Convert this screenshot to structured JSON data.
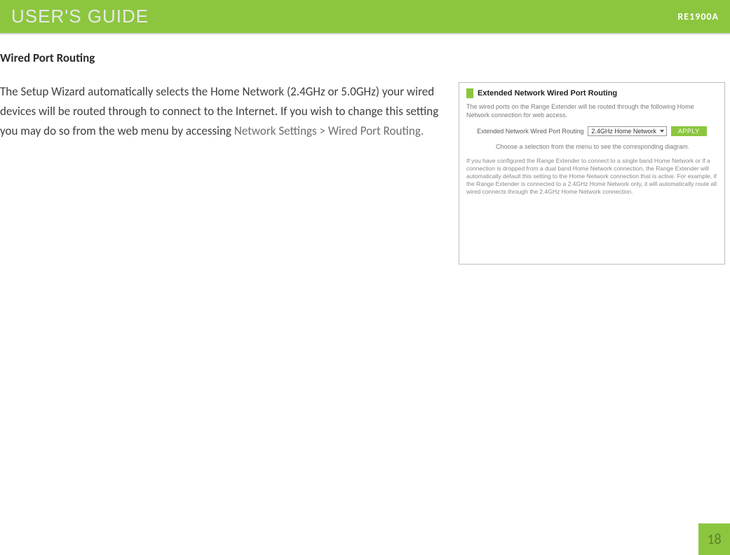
{
  "header": {
    "title": "USER'S GUIDE",
    "model": "RE1900A"
  },
  "section": {
    "heading": "Wired Port Routing",
    "body_pre": "The Setup Wizard automatically selects the Home Network (2.4GHz or 5.0GHz) your wired devices will be routed through to connect to the Internet. If you wish to change this setting you may do so from the web menu by accessing ",
    "body_nav": "Network Settings > Wired Port Routing."
  },
  "figure": {
    "title": "Extended Network Wired Port Routing",
    "intro": "The wired ports on the Range Extender will be routed through the following Home Network connection for web access.",
    "form_label": "Extended Network Wired Port Routing",
    "select_value": "2.4GHz Home Network",
    "apply_label": "APPLY",
    "choose_text": "Choose a selection from the menu to see the corresponding diagram.",
    "note_text": "If you have configured the Range Extender to connect to a single band Home Network or if a connection is dropped from a dual band Home Network connection, the Range Extender will automatically default this setting to the Home Network connection that is active. For example, if the Range Extender is connected to a 2.4GHz Home Network only, it will automatically route all wired connects through the 2.4GHz Home Network connection."
  },
  "page_number": "18"
}
